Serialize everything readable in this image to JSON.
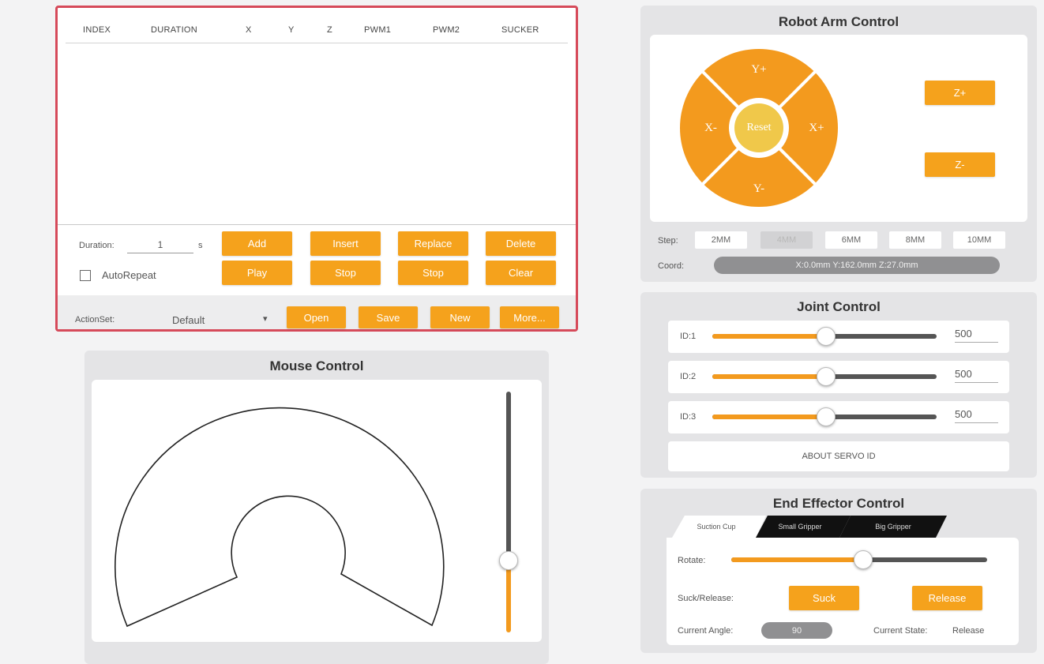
{
  "action_group": {
    "columns": [
      "INDEX",
      "DURATION",
      "X",
      "Y",
      "Z",
      "PWM1",
      "PWM2",
      "SUCKER"
    ],
    "duration_label": "Duration:",
    "duration_value": "1",
    "duration_unit": "s",
    "autorepeat_label": "AutoRepeat",
    "buttons_row1": [
      "Add",
      "Insert",
      "Replace",
      "Delete"
    ],
    "buttons_row2": [
      "Play",
      "Stop",
      "Stop",
      "Clear"
    ],
    "actionset_label": "ActionSet:",
    "actionset_value": "Default",
    "buttons_row3": [
      "Open",
      "Save",
      "New",
      "More..."
    ]
  },
  "robot_arm": {
    "title": "Robot Arm Control",
    "y_plus": "Y+",
    "y_minus": "Y-",
    "x_plus": "X+",
    "x_minus": "X-",
    "reset": "Reset",
    "z_plus": "Z+",
    "z_minus": "Z-",
    "step_label": "Step:",
    "steps": [
      "2MM",
      "4MM",
      "6MM",
      "8MM",
      "10MM"
    ],
    "selected_step": "4MM",
    "coord_label": "Coord:",
    "coord_value": "X:0.0mm  Y:162.0mm  Z:27.0mm"
  },
  "joint": {
    "title": "Joint Control",
    "joints": [
      {
        "label": "ID:1",
        "value": "500",
        "fraction": 0.5
      },
      {
        "label": "ID:2",
        "value": "500",
        "fraction": 0.5
      },
      {
        "label": "ID:3",
        "value": "500",
        "fraction": 0.5
      }
    ],
    "about": "ABOUT SERVO ID"
  },
  "mouse": {
    "title": "Mouse Control",
    "vertical_slider_fraction": 0.3
  },
  "end_effector": {
    "title": "End Effector Control",
    "tabs": [
      "Suction Cup",
      "Small Gripper",
      "Big Gripper"
    ],
    "active_tab": "Suction Cup",
    "rotate_label": "Rotate:",
    "rotate_fraction": 0.5,
    "suck_release_label": "Suck/Release:",
    "suck_button": "Suck",
    "release_button": "Release",
    "current_angle_label": "Current Angle:",
    "current_angle_value": "90",
    "current_state_label": "Current State:",
    "current_state_value": "Release"
  },
  "colors": {
    "accent": "#f5a21c",
    "highlight_border": "#d64a5a",
    "panel_bg": "#e4e4e6"
  }
}
